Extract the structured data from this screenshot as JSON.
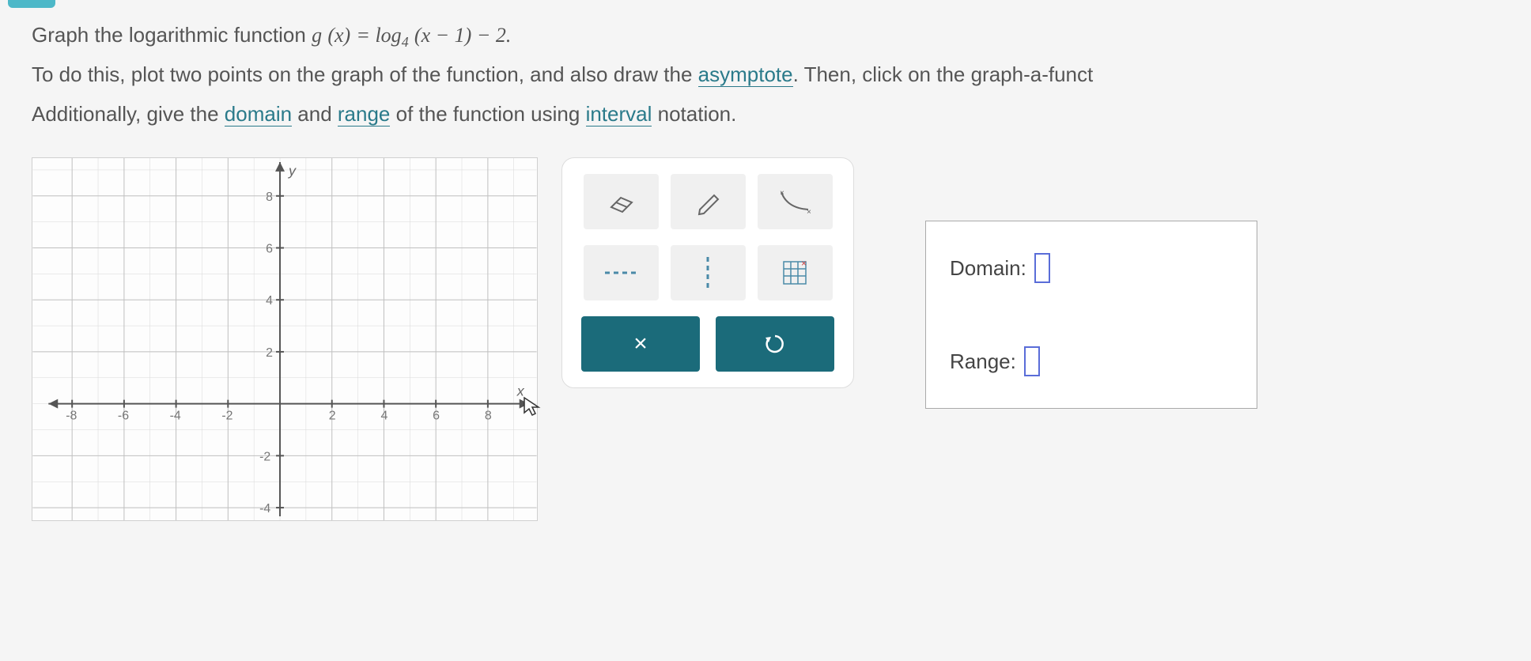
{
  "problem": {
    "line1_prefix": "Graph the logarithmic function ",
    "line1_func_g": "g",
    "line1_func_x": "(x)",
    "line1_equals": " = log",
    "line1_base": "4",
    "line1_arg": " (x − 1) − 2.",
    "line2_part1": "To do this, plot two points on the graph of the function, and also draw the ",
    "line2_asymptote": "asymptote",
    "line2_part2": ". Then, click on the graph-a-funct",
    "line3_part1": "Additionally, give the ",
    "line3_domain": "domain",
    "line3_part2": " and ",
    "line3_range": "range",
    "line3_part3": " of the function using ",
    "line3_interval": "interval",
    "line3_part4": " notation."
  },
  "graph": {
    "x_label": "x",
    "y_label": "y",
    "x_ticks": [
      "-8",
      "-6",
      "-4",
      "-2",
      "2",
      "4",
      "6",
      "8"
    ],
    "y_ticks": [
      "8",
      "6",
      "4",
      "2",
      "-2",
      "-4"
    ]
  },
  "tools": {
    "eraser": "eraser-icon",
    "pencil": "pencil-icon",
    "curve": "curve-icon",
    "hdashed": "hdashed-icon",
    "vdashed": "vdashed-icon",
    "grid": "grid-icon",
    "clear": "×",
    "undo": "↺"
  },
  "answers": {
    "domain_label": "Domain:",
    "range_label": "Range:"
  }
}
